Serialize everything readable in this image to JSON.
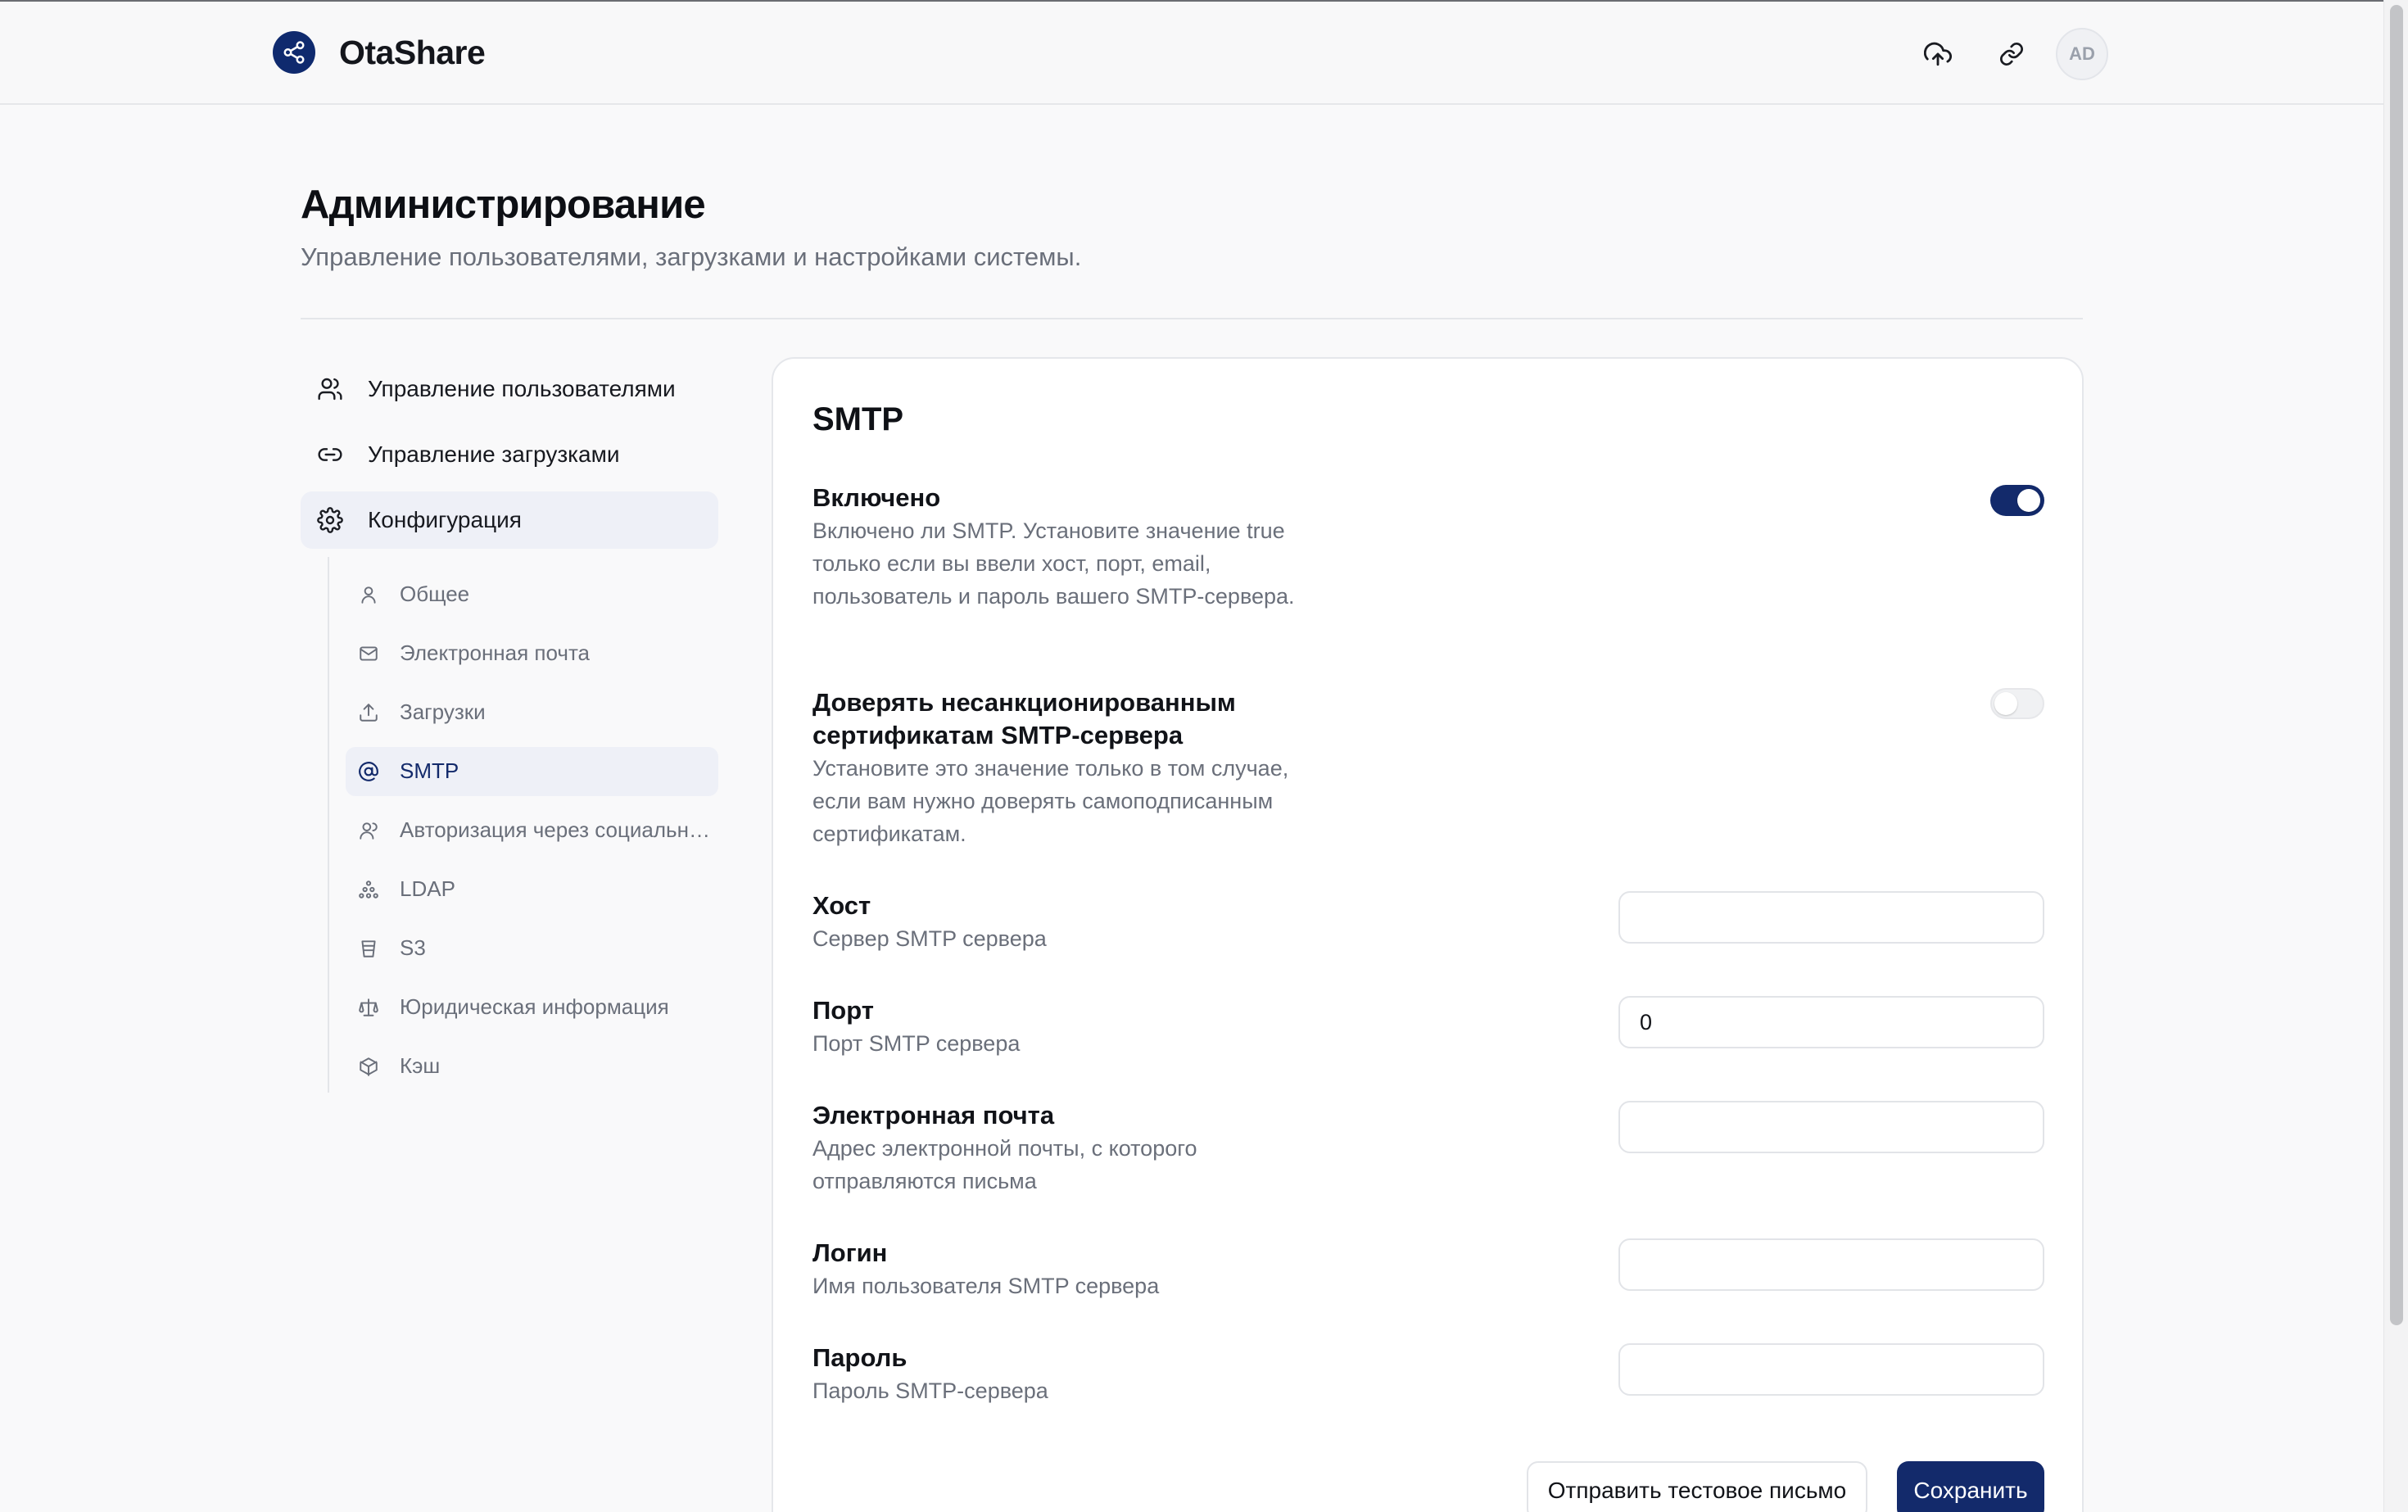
{
  "header": {
    "app_name": "OtaShare",
    "avatar_initials": "AD",
    "icons": [
      "share-icon",
      "cloud-upload-icon",
      "link-icon"
    ]
  },
  "page": {
    "title": "Администрирование",
    "subtitle": "Управление пользователями, загрузками и настройками системы."
  },
  "sidebar": {
    "items": [
      {
        "label": "Управление пользователями",
        "icon": "users-icon"
      },
      {
        "label": "Управление загрузками",
        "icon": "link-icon"
      },
      {
        "label": "Конфигурация",
        "icon": "gear-icon",
        "active": true
      }
    ],
    "sub_items": [
      {
        "label": "Общее",
        "icon": "user-icon"
      },
      {
        "label": "Электронная почта",
        "icon": "mail-icon"
      },
      {
        "label": "Загрузки",
        "icon": "upload-icon"
      },
      {
        "label": "SMTP",
        "icon": "at-icon",
        "active": true
      },
      {
        "label": "Авторизация через социальные сети",
        "icon": "users-icon"
      },
      {
        "label": "LDAP",
        "icon": "network-icon"
      },
      {
        "label": "S3",
        "icon": "bucket-icon"
      },
      {
        "label": "Юридическая информация",
        "icon": "scale-icon"
      },
      {
        "label": "Кэш",
        "icon": "box-icon"
      }
    ]
  },
  "smtp": {
    "title": "SMTP",
    "enabled": {
      "title": "Включено",
      "description": "Включено ли SMTP. Установите значение true только если вы ввели хост, порт, email, пользователь и пароль вашего SMTP-сервера.",
      "value": true
    },
    "trust_certs": {
      "title": "Доверять несанкционированным сертификатам SMTP-сервера",
      "description": "Установите это значение только в том случае, если вам нужно доверять самоподписанным сертификатам.",
      "value": false
    },
    "host": {
      "title": "Хост",
      "description": "Сервер SMTP сервера",
      "value": ""
    },
    "port": {
      "title": "Порт",
      "description": "Порт SMTP сервера",
      "value": "0"
    },
    "email": {
      "title": "Электронная почта",
      "description": "Адрес электронной почты, с которого отправляются письма",
      "value": ""
    },
    "login": {
      "title": "Логин",
      "description": "Имя пользователя SMTP сервера",
      "value": ""
    },
    "password": {
      "title": "Пароль",
      "description": "Пароль SMTP-сервера",
      "value": ""
    },
    "test_button": "Отправить тестовое письмо",
    "save_button": "Сохранить"
  },
  "colors": {
    "primary": "#132a6b",
    "background": "#f9f9fa",
    "muted_text": "#6a6f7a"
  }
}
